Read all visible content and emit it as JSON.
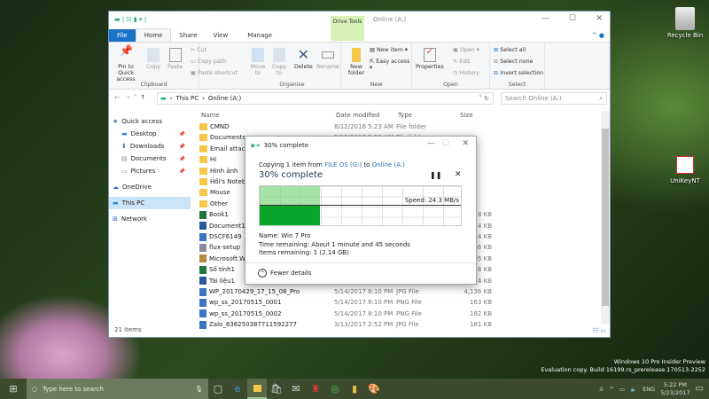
{
  "explorer": {
    "title": "Online (A:)",
    "context_tab": "Drive Tools",
    "tabs": [
      "File",
      "Home",
      "Share",
      "View",
      "Manage"
    ],
    "ribbon": {
      "clipboard": {
        "label": "Clipboard",
        "pin": "Pin to Quick access",
        "copy": "Copy",
        "paste": "Paste",
        "cut": "Cut",
        "copy_path": "Copy path",
        "paste_shortcut": "Paste shortcut"
      },
      "organise": {
        "label": "Organise",
        "move": "Move to",
        "copy": "Copy to",
        "delete": "Delete",
        "rename": "Rename"
      },
      "new": {
        "label": "New",
        "new_folder": "New folder",
        "new_item": "New item ▾",
        "easy_access": "Easy access ▾"
      },
      "open": {
        "label": "Open",
        "properties": "Properties",
        "open": "Open ▾",
        "edit": "Edit",
        "history": "History"
      },
      "select": {
        "label": "Select",
        "all": "Select all",
        "none": "Select none",
        "invert": "Invert selection"
      }
    },
    "breadcrumb": [
      "This PC",
      "Online (A:)"
    ],
    "search_placeholder": "Search Online (A:)",
    "nav": [
      {
        "label": "Quick access"
      },
      {
        "label": "Desktop",
        "pinned": true
      },
      {
        "label": "Downloads",
        "pinned": true
      },
      {
        "label": "Documents",
        "pinned": true
      },
      {
        "label": "Pictures",
        "pinned": true
      },
      {
        "label": "OneDrive"
      },
      {
        "label": "This PC",
        "selected": true
      },
      {
        "label": "Network"
      }
    ],
    "columns": [
      "Name",
      "Date modified",
      "Type",
      "Size"
    ],
    "files": [
      {
        "name": "CMND",
        "date": "8/12/2016 5:23 AM",
        "type": "File folder",
        "size": "",
        "kind": "folder"
      },
      {
        "name": "Documents",
        "date": "5/19/2017 5:23 AM",
        "type": "File folder",
        "size": "",
        "kind": "folder"
      },
      {
        "name": "Email attach",
        "date": "",
        "type": "",
        "size": "",
        "kind": "folder"
      },
      {
        "name": "Hi",
        "date": "",
        "type": "",
        "size": "",
        "kind": "folder"
      },
      {
        "name": "Hình ảnh",
        "date": "",
        "type": "",
        "size": "",
        "kind": "folder"
      },
      {
        "name": "Hồi's Noteb",
        "date": "",
        "type": "",
        "size": "",
        "kind": "folder"
      },
      {
        "name": "Mouse",
        "date": "",
        "type": "",
        "size": "",
        "kind": "folder"
      },
      {
        "name": "Other",
        "date": "",
        "type": "",
        "size": "",
        "kind": "folder"
      },
      {
        "name": "Book1",
        "date": "",
        "type": "",
        "size": "8 KB",
        "kind": "excel"
      },
      {
        "name": "Document1",
        "date": "",
        "type": "",
        "size": "14 KB",
        "kind": "word"
      },
      {
        "name": "DSCF6149",
        "date": "",
        "type": "",
        "size": "54 KB",
        "kind": "image"
      },
      {
        "name": "flux-setup",
        "date": "",
        "type": "",
        "size": "486 KB",
        "kind": "app"
      },
      {
        "name": "Microsoft.W",
        "date": "",
        "type": "",
        "size": "795 KB",
        "kind": "archive"
      },
      {
        "name": "Số tính1",
        "date": "",
        "type": "",
        "size": "8 KB",
        "kind": "excel"
      },
      {
        "name": "Tài liệu1",
        "date": "",
        "type": "",
        "size": "14 KB",
        "kind": "word"
      },
      {
        "name": "WP_20170429_17_15_08_Pro",
        "date": "5/14/2017 8:10 PM",
        "type": "JPG File",
        "size": "4,136 KB",
        "kind": "image"
      },
      {
        "name": "wp_ss_20170515_0001",
        "date": "5/14/2017 8:10 PM",
        "type": "PNG File",
        "size": "163 KB",
        "kind": "image"
      },
      {
        "name": "wp_ss_20170515_0002",
        "date": "5/14/2017 8:10 PM",
        "type": "PNG File",
        "size": "182 KB",
        "kind": "image"
      },
      {
        "name": "Zalo_636250387711592277",
        "date": "3/13/2017 2:52 PM",
        "type": "JPG File",
        "size": "181 KB",
        "kind": "image"
      }
    ],
    "status": "21 items"
  },
  "copy_dialog": {
    "title": "30% complete",
    "copying_prefix": "Copying 1 item from",
    "source": "FILE OS (G:)",
    "to": "to",
    "dest": "Online (A:)",
    "heading": "30% complete",
    "progress_percent": 30,
    "speed": "Speed: 24.3 MB/s",
    "name": "Name:  Win 7 Pro",
    "time_remaining": "Time remaining:  About 1 minute and 45 seconds",
    "items_remaining": "Items remaining:  1 (2.14 GB)",
    "fewer_details": "Fewer details"
  },
  "desktop": {
    "recycle_bin": "Recycle Bin",
    "unikey": "UniKeyNT",
    "watermark1": "Windows 10 Pro Insider Preview",
    "watermark2": "Evaluation copy. Build 16199.rs_prerelease.170513-2252"
  },
  "taskbar": {
    "search_placeholder": "Type here to search",
    "lang": "ENG",
    "time": "5:22 PM",
    "date": "5/23/2017"
  }
}
